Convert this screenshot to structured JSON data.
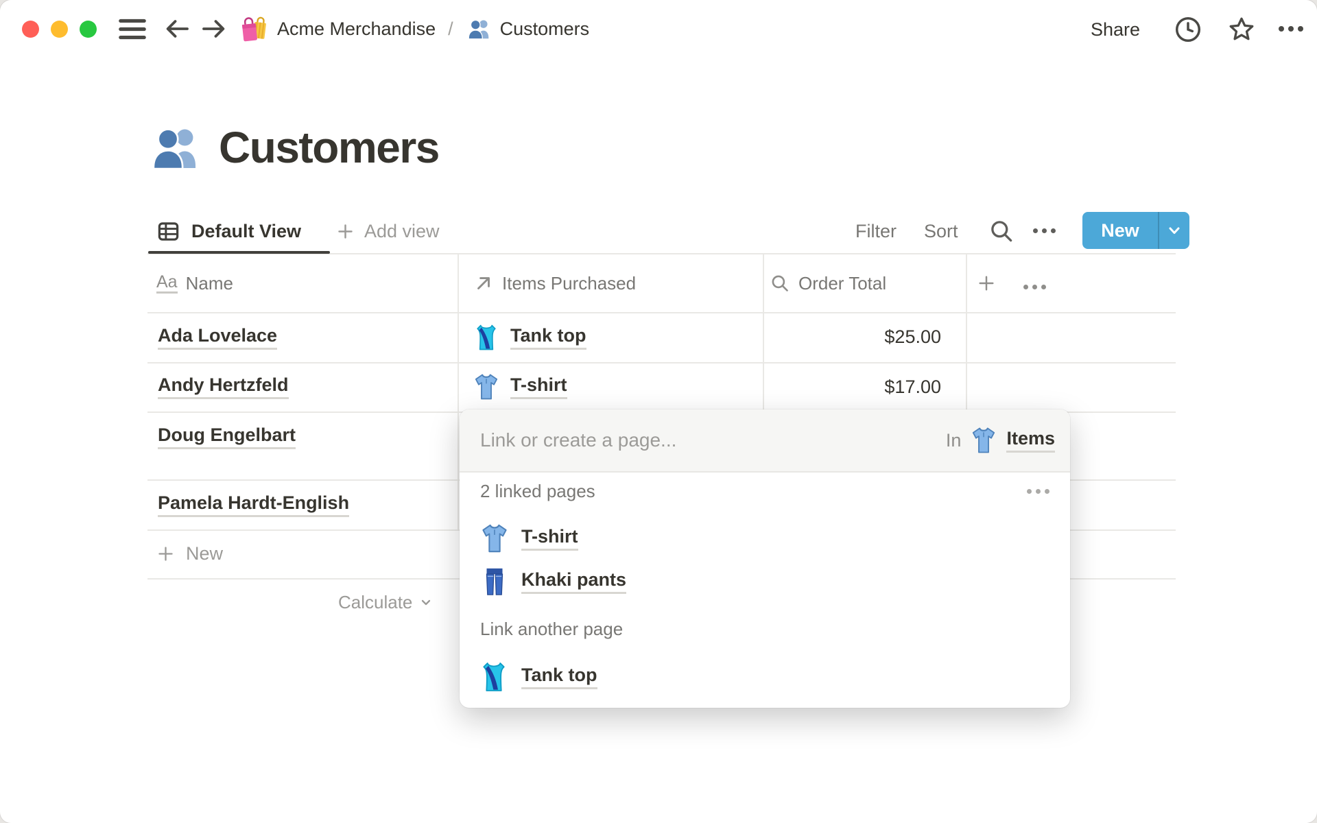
{
  "titlebar": {
    "share": "Share",
    "breadcrumb": {
      "workspace": "Acme Merchandise",
      "separator": "/",
      "page": "Customers"
    }
  },
  "page": {
    "title": "Customers"
  },
  "toolbar": {
    "active_view": "Default View",
    "add_view": "Add view",
    "filter": "Filter",
    "sort": "Sort",
    "new": "New"
  },
  "table": {
    "columns": [
      {
        "label": "Name",
        "icon": "title-property-icon"
      },
      {
        "label": "Items Purchased",
        "icon": "relation-property-icon"
      },
      {
        "label": "Order Total",
        "icon": "rollup-property-icon"
      }
    ],
    "rows": [
      {
        "name": "Ada Lovelace",
        "item": "Tank top",
        "item_icon": "tank-top-icon",
        "total": "$25.00"
      },
      {
        "name": "Andy Hertzfeld",
        "item": "T-shirt",
        "item_icon": "t-shirt-icon",
        "total": "$17.00"
      },
      {
        "name": "Doug Engelbart",
        "item": "",
        "total": ""
      },
      {
        "name": "Pamela Hardt-English",
        "item": "",
        "total": ""
      }
    ],
    "new_row": "New",
    "calculate": "Calculate"
  },
  "popup": {
    "placeholder": "Link or create a page...",
    "scope": {
      "in": "In",
      "database": "Items",
      "database_icon": "t-shirt-icon"
    },
    "linked_count_label": "2 linked pages",
    "linked_pages": [
      {
        "label": "T-shirt",
        "icon": "t-shirt-icon"
      },
      {
        "label": "Khaki pants",
        "icon": "jeans-icon"
      }
    ],
    "link_another_label": "Link another page",
    "suggested_pages": [
      {
        "label": "Tank top",
        "icon": "tank-top-icon"
      }
    ]
  },
  "icons": {
    "workspace": "shopping-bags",
    "page": "busts-in-silhouette",
    "active_view": "table-grid"
  },
  "colors": {
    "accent_blue": "#4CA8D8",
    "text": "#37352F",
    "secondary_gray": "#787774",
    "light_gray": "#9B9A97",
    "border": "#E9E8E5",
    "traffic_red": "#FF5F57",
    "traffic_yellow": "#FEBC2E",
    "traffic_green": "#28C840"
  }
}
